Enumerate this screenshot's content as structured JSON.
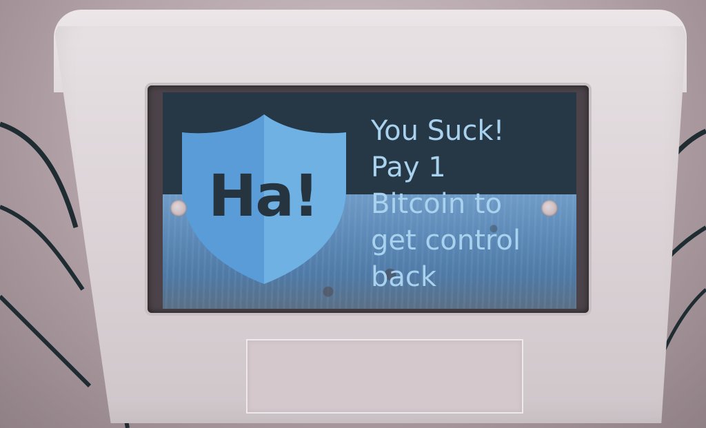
{
  "screen": {
    "shield_text": "Ha!",
    "message_lines": [
      "You Suck!",
      "Pay 1",
      "Bitcoin to",
      "get control",
      "back"
    ]
  },
  "colors": {
    "screen_background": "#263746",
    "shield_light": "#6fb1e3",
    "shield_dark": "#4c8fcc",
    "message_text": "#a9d2ee",
    "shield_text": "#263440",
    "device_body": "#e2dbde"
  },
  "icons": {
    "shield": "shield-icon"
  }
}
